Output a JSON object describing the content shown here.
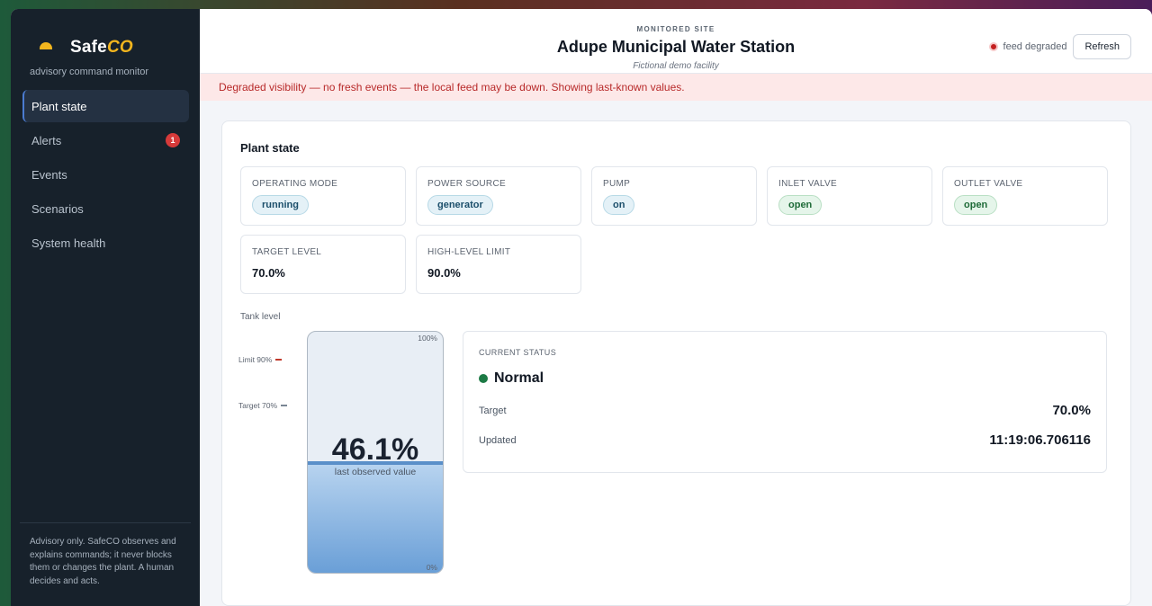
{
  "brand": {
    "name_main": "Safe",
    "name_accent": "CO",
    "subtitle": "advisory command monitor",
    "icon": "hardhat-icon"
  },
  "nav": {
    "items": [
      {
        "label": "Plant state",
        "active": true
      },
      {
        "label": "Alerts",
        "badge": "1"
      },
      {
        "label": "Events"
      },
      {
        "label": "Scenarios"
      },
      {
        "label": "System health"
      }
    ]
  },
  "sidebar_footer": "Advisory only. SafeCO observes and explains commands; it never blocks them or changes the plant. A human decides and acts.",
  "header": {
    "kicker": "MONITORED SITE",
    "title": "Adupe Municipal Water Station",
    "subtitle": "Fictional demo facility",
    "feed_status": "feed degraded",
    "feed_color": "#c41f1f",
    "refresh_label": "Refresh"
  },
  "banner": "Degraded visibility — no fresh events — the local feed may be down. Showing last-known values.",
  "plant_state": {
    "title": "Plant state",
    "tiles": [
      {
        "label": "OPERATING MODE",
        "value": "running"
      },
      {
        "label": "POWER SOURCE",
        "value": "generator"
      },
      {
        "label": "PUMP",
        "value": "on"
      },
      {
        "label": "INLET VALVE",
        "value": "open"
      },
      {
        "label": "OUTLET VALVE",
        "value": "open"
      },
      {
        "label": "TARGET LEVEL",
        "value": "70.0%"
      },
      {
        "label": "HIGH-LEVEL LIMIT",
        "value": "90.0%"
      }
    ],
    "tank": {
      "label": "Tank level",
      "level_percent": 46.1,
      "value_text": "46.1%",
      "caption": "last observed value",
      "top_label": "100%",
      "bottom_label": "0%",
      "limit_label": "Limit 90%",
      "limit_percent": 90,
      "limit_color": "#c0392b",
      "target_label": "Target 70%",
      "target_percent": 70,
      "target_color": "#7a8694"
    },
    "status": {
      "label": "CURRENT STATUS",
      "value": "Normal",
      "color": "#1c7a45",
      "target_key": "Target",
      "target_value": "70.0%",
      "updated_key": "Updated",
      "updated_value": "11:19:06.706116"
    }
  }
}
